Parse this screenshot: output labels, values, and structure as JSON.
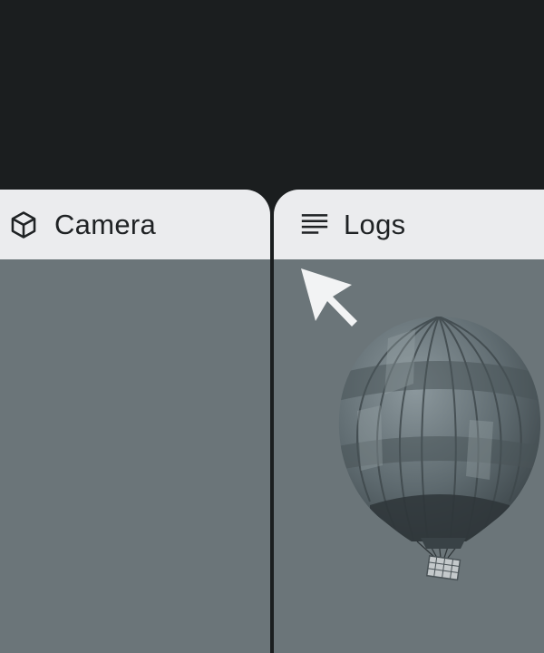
{
  "panes": [
    {
      "label": "Camera",
      "icon": "cube-icon"
    },
    {
      "label": "Logs",
      "icon": "text-lines-icon"
    }
  ],
  "cursor": {
    "icon": "cursor-arrow-icon"
  },
  "colors": {
    "background": "#1b1e1f",
    "tab_header": "#ebecee",
    "pane_body": "#6b7579",
    "text": "#1f2224"
  }
}
